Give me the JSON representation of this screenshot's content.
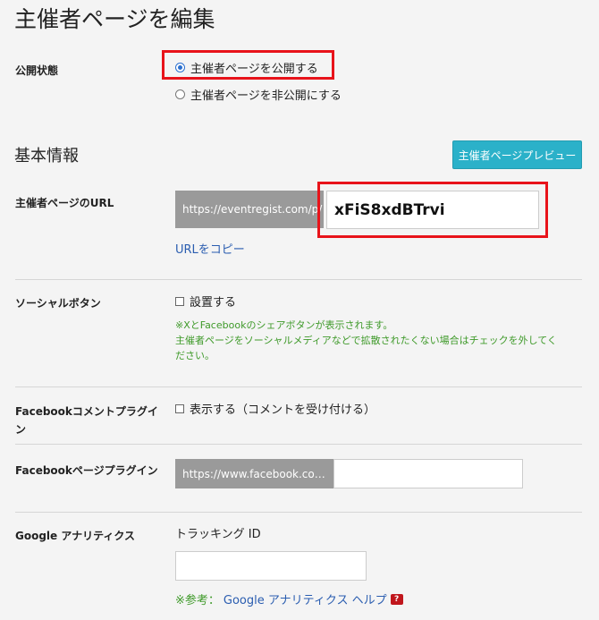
{
  "page_title": "主催者ページを編集",
  "publish": {
    "label": "公開状態",
    "options": [
      {
        "label": "主催者ページを公開する",
        "checked": true
      },
      {
        "label": "主催者ページを非公開にする",
        "checked": false
      }
    ]
  },
  "basic_info": {
    "heading": "基本情報",
    "preview_button": "主催者ページプレビュー"
  },
  "url": {
    "label": "主催者ページのURL",
    "prefix": "https://eventregist.com/p/",
    "value": "xFiS8xdBTrvi",
    "copy_link": "URLをコピー"
  },
  "social": {
    "label": "ソーシャルボタン",
    "checkbox_label": "設置する",
    "note_lines": [
      "※XとFacebookのシェアボタンが表示されます。",
      "主催者ページをソーシャルメディアなどで拡散されたくない場合はチェックを外してく",
      "ださい。"
    ]
  },
  "fb_comment": {
    "label_line1": "Facebookコメントプラグイ",
    "label_line2": "ン",
    "checkbox_label": "表示する（コメントを受け付ける）"
  },
  "fb_page": {
    "label": "Facebookページプラグイン",
    "prefix": "https://www.facebook.co…",
    "value": ""
  },
  "ga": {
    "label": "Google アナリティクス",
    "tracking_label": "トラッキング ID",
    "tracking_value": "",
    "help_prefix": "※参考：",
    "help_link": "Google アナリティクス ヘルプ",
    "help_icon": "?"
  }
}
